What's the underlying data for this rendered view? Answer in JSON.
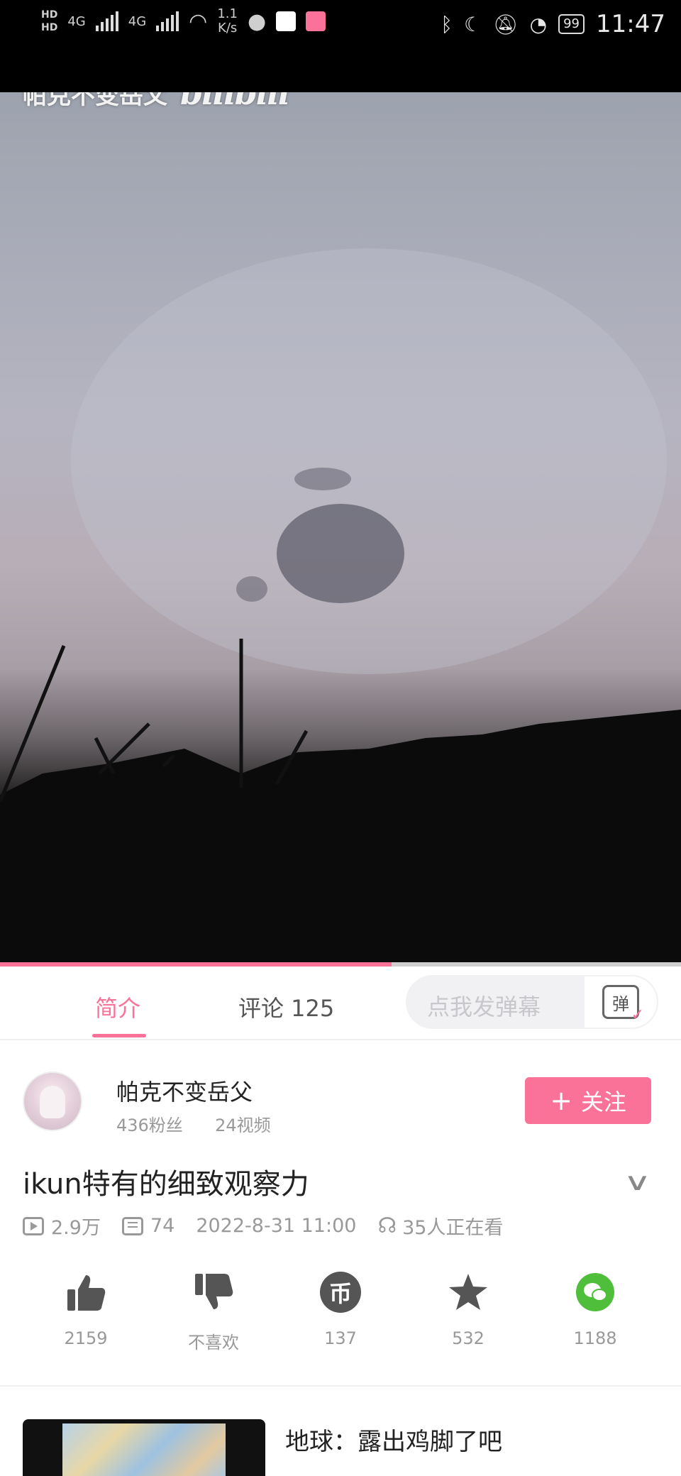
{
  "status_bar": {
    "hd_top": "HD",
    "hd_bottom": "HD",
    "signal_1": "4G",
    "signal_2": "4G",
    "net_speed_value": "1.1",
    "net_speed_unit": "K/s",
    "battery": "99",
    "time": "11:47"
  },
  "video": {
    "uploader_watermark": "帕克不变岳父",
    "logo": "bilibili",
    "progress": 0.575
  },
  "tabs": {
    "intro": "简介",
    "comments": "评论 125",
    "danmaku_placeholder": "点我发弹幕",
    "danmaku_icon_text": "弹"
  },
  "uploader": {
    "name": "帕克不变岳父",
    "fans": "436粉丝",
    "videos": "24视频",
    "follow_label": "关注"
  },
  "video_info": {
    "title": "ikun特有的细致观察力",
    "views": "2.9万",
    "danmaku_count": "74",
    "date": "2022-8-31 11:00",
    "watching": "35人正在看"
  },
  "actions": {
    "like": "2159",
    "dislike": "不喜欢",
    "coin": "137",
    "coin_symbol": "币",
    "favorite": "532",
    "share": "1188"
  },
  "recommended": {
    "title": "地球：露出鸡脚了吧"
  },
  "colors": {
    "accent": "#fb7299",
    "wechat": "#4fbf3b"
  }
}
